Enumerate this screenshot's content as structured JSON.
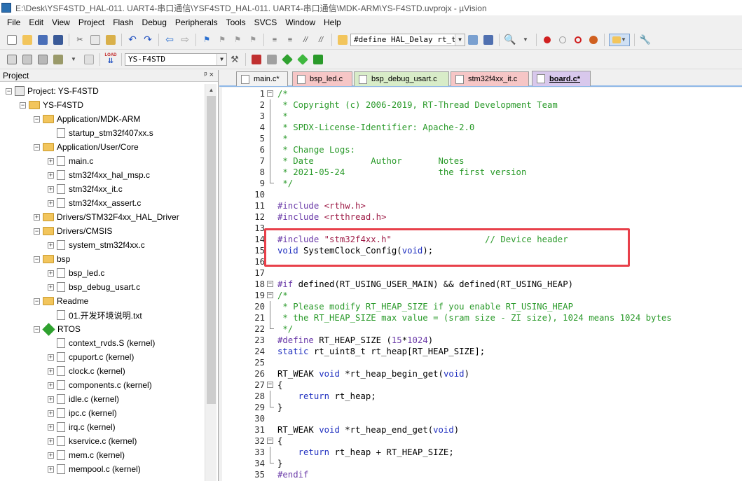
{
  "window": {
    "title": "E:\\Desk\\YSF4STD_HAL-011. UART4-串口通信\\YSF4STD_HAL-011. UART4-串口通信\\MDK-ARM\\YS-F4STD.uvprojx - µVision"
  },
  "menu": [
    "File",
    "Edit",
    "View",
    "Project",
    "Flash",
    "Debug",
    "Peripherals",
    "Tools",
    "SVCS",
    "Window",
    "Help"
  ],
  "toolbar": {
    "find_combo": "#define HAL_Delay rt_thr",
    "target_combo": "YS-F4STD",
    "load_label": "LOAD"
  },
  "project_panel": {
    "title": "Project",
    "controls": "ᵖ ×"
  },
  "tree": [
    {
      "label": "Project: YS-F4STD",
      "level": 0,
      "kind": "project",
      "exp": "−"
    },
    {
      "label": "YS-F4STD",
      "level": 1,
      "kind": "target",
      "exp": "−"
    },
    {
      "label": "Application/MDK-ARM",
      "level": 2,
      "kind": "folder",
      "exp": "−"
    },
    {
      "label": "startup_stm32f407xx.s",
      "level": 3,
      "kind": "file",
      "exp": ""
    },
    {
      "label": "Application/User/Core",
      "level": 2,
      "kind": "folder",
      "exp": "−"
    },
    {
      "label": "main.c",
      "level": 3,
      "kind": "file",
      "exp": "+"
    },
    {
      "label": "stm32f4xx_hal_msp.c",
      "level": 3,
      "kind": "file",
      "exp": "+"
    },
    {
      "label": "stm32f4xx_it.c",
      "level": 3,
      "kind": "file",
      "exp": "+"
    },
    {
      "label": "stm32f4xx_assert.c",
      "level": 3,
      "kind": "file",
      "exp": "+"
    },
    {
      "label": "Drivers/STM32F4xx_HAL_Driver",
      "level": 2,
      "kind": "folder",
      "exp": "+"
    },
    {
      "label": "Drivers/CMSIS",
      "level": 2,
      "kind": "folder",
      "exp": "−"
    },
    {
      "label": "system_stm32f4xx.c",
      "level": 3,
      "kind": "file",
      "exp": "+"
    },
    {
      "label": "bsp",
      "level": 2,
      "kind": "folder",
      "exp": "−"
    },
    {
      "label": "bsp_led.c",
      "level": 3,
      "kind": "file",
      "exp": "+"
    },
    {
      "label": "bsp_debug_usart.c",
      "level": 3,
      "kind": "file",
      "exp": "+"
    },
    {
      "label": "Readme",
      "level": 2,
      "kind": "folder",
      "exp": "−"
    },
    {
      "label": "01.开发环境说明.txt",
      "level": 3,
      "kind": "file",
      "exp": ""
    },
    {
      "label": "RTOS",
      "level": 2,
      "kind": "rtos",
      "exp": "−"
    },
    {
      "label": "context_rvds.S (kernel)",
      "level": 3,
      "kind": "file",
      "exp": ""
    },
    {
      "label": "cpuport.c (kernel)",
      "level": 3,
      "kind": "file",
      "exp": "+"
    },
    {
      "label": "clock.c (kernel)",
      "level": 3,
      "kind": "file",
      "exp": "+"
    },
    {
      "label": "components.c (kernel)",
      "level": 3,
      "kind": "file",
      "exp": "+"
    },
    {
      "label": "idle.c (kernel)",
      "level": 3,
      "kind": "file",
      "exp": "+"
    },
    {
      "label": "ipc.c (kernel)",
      "level": 3,
      "kind": "file",
      "exp": "+"
    },
    {
      "label": "irq.c (kernel)",
      "level": 3,
      "kind": "file",
      "exp": "+"
    },
    {
      "label": "kservice.c (kernel)",
      "level": 3,
      "kind": "file",
      "exp": "+"
    },
    {
      "label": "mem.c (kernel)",
      "level": 3,
      "kind": "file",
      "exp": "+"
    },
    {
      "label": "mempool.c (kernel)",
      "level": 3,
      "kind": "file",
      "exp": "+"
    }
  ],
  "tabs": [
    {
      "label": "main.c*",
      "bg": "#f2f2f2",
      "active": false
    },
    {
      "label": "bsp_led.c",
      "bg": "#f6c6c6",
      "active": false
    },
    {
      "label": "bsp_debug_usart.c",
      "bg": "#d8ecc8",
      "active": false
    },
    {
      "label": "stm32f4xx_it.c",
      "bg": "#f6c6c6",
      "active": false
    },
    {
      "label": "board.c*",
      "bg": "#d8c8ec",
      "active": true
    }
  ],
  "code": [
    {
      "n": "1",
      "fold": "box",
      "seg": [
        [
          "c-com",
          "/*"
        ]
      ]
    },
    {
      "n": "2",
      "fold": "line",
      "seg": [
        [
          "c-com",
          " * Copyright (c) 2006-2019, RT-Thread Development Team"
        ]
      ]
    },
    {
      "n": "3",
      "fold": "line",
      "seg": [
        [
          "c-com",
          " *"
        ]
      ]
    },
    {
      "n": "4",
      "fold": "line",
      "seg": [
        [
          "c-com",
          " * SPDX-License-Identifier: Apache-2.0"
        ]
      ]
    },
    {
      "n": "5",
      "fold": "line",
      "seg": [
        [
          "c-com",
          " *"
        ]
      ]
    },
    {
      "n": "6",
      "fold": "line",
      "seg": [
        [
          "c-com",
          " * Change Logs:"
        ]
      ]
    },
    {
      "n": "7",
      "fold": "line",
      "seg": [
        [
          "c-com",
          " * Date           Author       Notes"
        ]
      ]
    },
    {
      "n": "8",
      "fold": "line",
      "seg": [
        [
          "c-com",
          " * 2021-05-24                  the first version"
        ]
      ]
    },
    {
      "n": "9",
      "fold": "end",
      "seg": [
        [
          "c-com",
          " */"
        ]
      ]
    },
    {
      "n": "10",
      "fold": "",
      "seg": []
    },
    {
      "n": "11",
      "fold": "",
      "seg": [
        [
          "c-pp",
          "#include "
        ],
        [
          "c-str",
          "<rthw.h>"
        ]
      ]
    },
    {
      "n": "12",
      "fold": "",
      "seg": [
        [
          "c-pp",
          "#include "
        ],
        [
          "c-str",
          "<rtthread.h>"
        ]
      ]
    },
    {
      "n": "13",
      "fold": "",
      "seg": []
    },
    {
      "n": "14",
      "fold": "",
      "seg": [
        [
          "c-pp",
          "#include "
        ],
        [
          "c-str",
          "\"stm32f4xx.h\""
        ],
        [
          "",
          "                  "
        ],
        [
          "c-com",
          "// Device header"
        ]
      ]
    },
    {
      "n": "15",
      "fold": "",
      "seg": [
        [
          "c-kw",
          "void"
        ],
        [
          "",
          " SystemClock_Config("
        ],
        [
          "c-kw",
          "void"
        ],
        [
          "",
          ");"
        ]
      ]
    },
    {
      "n": "16",
      "fold": "",
      "seg": []
    },
    {
      "n": "17",
      "fold": "",
      "seg": []
    },
    {
      "n": "18",
      "fold": "box",
      "seg": [
        [
          "c-pp",
          "#if"
        ],
        [
          "",
          " defined(RT_USING_USER_MAIN) && defined(RT_USING_HEAP)"
        ]
      ]
    },
    {
      "n": "19",
      "fold": "box",
      "seg": [
        [
          "c-com",
          "/*"
        ]
      ]
    },
    {
      "n": "20",
      "fold": "line",
      "seg": [
        [
          "c-com",
          " * Please modify RT_HEAP_SIZE if you enable RT_USING_HEAP"
        ]
      ]
    },
    {
      "n": "21",
      "fold": "line",
      "seg": [
        [
          "c-com",
          " * the RT_HEAP_SIZE max value = (sram size - ZI size), 1024 means 1024 bytes"
        ]
      ]
    },
    {
      "n": "22",
      "fold": "end",
      "seg": [
        [
          "c-com",
          " */"
        ]
      ]
    },
    {
      "n": "23",
      "fold": "",
      "seg": [
        [
          "c-pp",
          "#define"
        ],
        [
          "",
          " RT_HEAP_SIZE ("
        ],
        [
          "c-num",
          "15"
        ],
        [
          "",
          "*"
        ],
        [
          "c-num",
          "1024"
        ],
        [
          "",
          ")"
        ]
      ]
    },
    {
      "n": "24",
      "fold": "",
      "seg": [
        [
          "c-kw",
          "static"
        ],
        [
          "",
          " rt_uint8_t rt_heap[RT_HEAP_SIZE];"
        ]
      ]
    },
    {
      "n": "25",
      "fold": "",
      "seg": []
    },
    {
      "n": "26",
      "fold": "",
      "seg": [
        [
          "",
          "RT_WEAK "
        ],
        [
          "c-kw",
          "void"
        ],
        [
          "",
          " *rt_heap_begin_get("
        ],
        [
          "c-kw",
          "void"
        ],
        [
          "",
          ")"
        ]
      ]
    },
    {
      "n": "27",
      "fold": "box",
      "seg": [
        [
          "",
          "{"
        ]
      ]
    },
    {
      "n": "28",
      "fold": "line",
      "seg": [
        [
          "",
          "    "
        ],
        [
          "c-kw",
          "return"
        ],
        [
          "",
          " rt_heap;"
        ]
      ]
    },
    {
      "n": "29",
      "fold": "end",
      "seg": [
        [
          "",
          "}"
        ]
      ]
    },
    {
      "n": "30",
      "fold": "",
      "seg": []
    },
    {
      "n": "31",
      "fold": "",
      "seg": [
        [
          "",
          "RT_WEAK "
        ],
        [
          "c-kw",
          "void"
        ],
        [
          "",
          " *rt_heap_end_get("
        ],
        [
          "c-kw",
          "void"
        ],
        [
          "",
          ")"
        ]
      ]
    },
    {
      "n": "32",
      "fold": "box",
      "seg": [
        [
          "",
          "{"
        ]
      ]
    },
    {
      "n": "33",
      "fold": "line",
      "seg": [
        [
          "",
          "    "
        ],
        [
          "c-kw",
          "return"
        ],
        [
          "",
          " rt_heap + RT_HEAP_SIZE;"
        ]
      ]
    },
    {
      "n": "34",
      "fold": "end",
      "seg": [
        [
          "",
          "}"
        ]
      ]
    },
    {
      "n": "35",
      "fold": "",
      "seg": [
        [
          "c-pp",
          "#endif"
        ]
      ]
    }
  ]
}
